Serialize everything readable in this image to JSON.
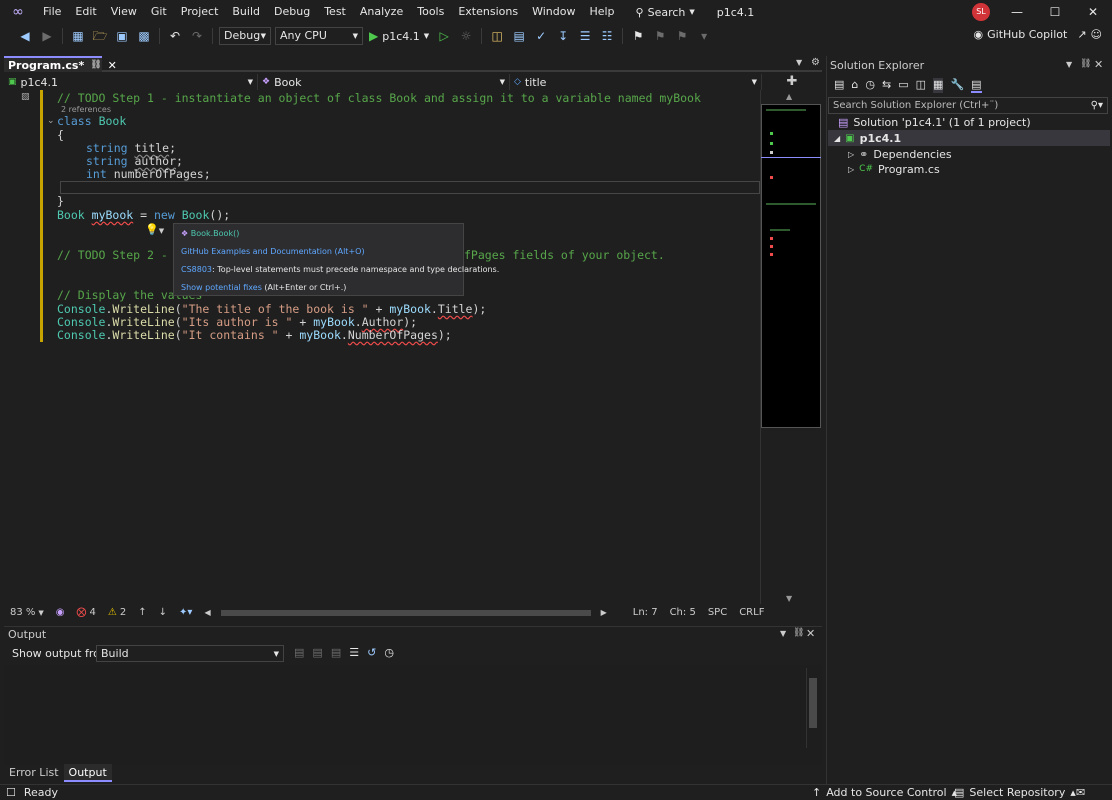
{
  "menu": [
    "File",
    "Edit",
    "View",
    "Git",
    "Project",
    "Build",
    "Debug",
    "Test",
    "Analyze",
    "Tools",
    "Extensions",
    "Window",
    "Help"
  ],
  "search_label": "Search",
  "solution_title": "p1c4.1",
  "avatar_initials": "SL",
  "toolbar": {
    "config": "Debug",
    "platform": "Any CPU",
    "run_target": "p1c4.1"
  },
  "copilot_label": "GitHub Copilot",
  "doc_tab": "Program.cs*",
  "nav": {
    "project": "p1c4.1",
    "type": "Book",
    "member": "title"
  },
  "code": {
    "l1": "// TODO Step 1 - instantiate an object of class Book and assign it to a variable named myBook",
    "refs": "2 references",
    "l2_kw": "class",
    "l2_ty": "Book",
    "brace_open": "{",
    "f1_kw": "string",
    "f1_id": "title",
    "f2_kw": "string",
    "f2_id": "author",
    "f3_kw": "int",
    "f3_id": "numberOfPages",
    "brace_close": "}",
    "inst_ty": "Book",
    "inst_var": "myBook",
    "inst_eq": " = ",
    "inst_new": "new",
    "inst_ctor": "Book",
    "inst_end": "();",
    "l_step2_a": "// TODO Step 2 - a",
    "l_step2_b": "fPages fields of your object.",
    "l_display": "// Display the values",
    "wl1_cls": "Console",
    "wl1_fn": "WriteLine",
    "wl1_str": "\"The title of the book is \"",
    "wl1_plus": " + ",
    "wl1_obj": "myBook",
    "wl1_prop": "Title",
    "wl2_cls": "Console",
    "wl2_fn": "WriteLine",
    "wl2_str": "\"Its author is \"",
    "wl2_plus": " + ",
    "wl2_obj": "myBook",
    "wl2_prop": "Author",
    "wl3_cls": "Console",
    "wl3_fn": "WriteLine",
    "wl3_str": "\"It contains \"",
    "wl3_plus": " + ",
    "wl3_obj": "myBook",
    "wl3_prop": "NumberOfPages"
  },
  "popup": {
    "signature": "Book.Book()",
    "docs_link": "GitHub Examples and Documentation (Alt+O)",
    "error_code": "CS8803",
    "error_msg": ": Top-level statements must precede namespace and type declarations.",
    "fix_link": "Show potential fixes",
    "fix_shortcut": "(Alt+Enter or Ctrl+.)"
  },
  "editor_status": {
    "zoom": "83 %",
    "errors": "4",
    "warnings": "2",
    "line": "Ln: 7",
    "col": "Ch: 5",
    "spacing": "SPC",
    "eol": "CRLF"
  },
  "output": {
    "title": "Output",
    "from_label": "Show output from:",
    "source": "Build"
  },
  "bottom_tabs": [
    "Error List",
    "Output"
  ],
  "solution_explorer": {
    "title": "Solution Explorer",
    "search_placeholder": "Search Solution Explorer (Ctrl+¨)",
    "solution": "Solution 'p1c4.1' (1 of 1 project)",
    "project": "p1c4.1",
    "dependencies": "Dependencies",
    "file": "Program.cs"
  },
  "statusbar": {
    "ready": "Ready",
    "source_control": "Add to Source Control",
    "repository": "Select Repository"
  },
  "colors": {
    "accent": "#8c8cff",
    "error": "#f14c4c",
    "comment": "#57a64a",
    "keyword": "#569cd6",
    "type": "#4ec9b0"
  }
}
